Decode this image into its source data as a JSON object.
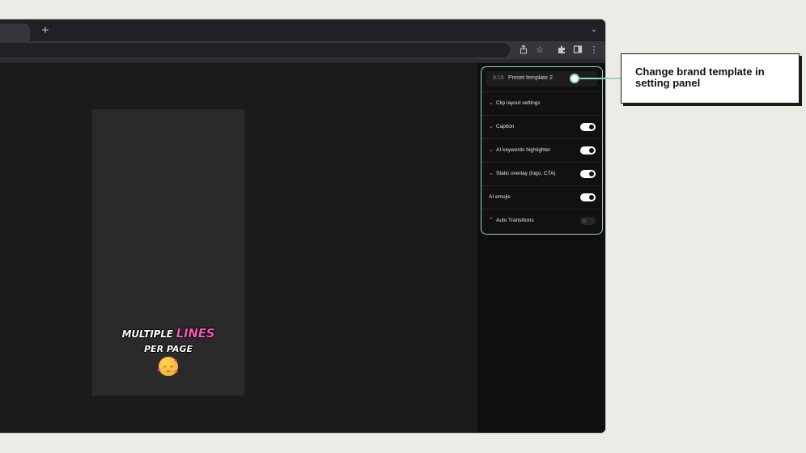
{
  "browser": {
    "new_tab_symbol": "+",
    "tab_menu_symbol": "⌄",
    "toolbar_icons": [
      "share-icon",
      "star-icon",
      "extensions-icon",
      "sidepanel-icon",
      "menu-icon"
    ]
  },
  "preview": {
    "caption_line1_prefix": "MULTIPLE",
    "caption_line1_highlight": "LINES",
    "caption_line2": "PER PAGE",
    "emoji": "smiling-face-with-hearts"
  },
  "panel": {
    "preset": {
      "ratio": "9:16",
      "name": "Preset template 2"
    },
    "rows": [
      {
        "label": "Clip layout settings",
        "chevron": "down",
        "toggle": null
      },
      {
        "label": "Caption",
        "chevron": "down",
        "toggle": true
      },
      {
        "label": "AI keywords highlighter",
        "chevron": "down",
        "toggle": true
      },
      {
        "label": "Static overlay (logo, CTA)",
        "chevron": "down",
        "toggle": true
      },
      {
        "label": "AI emojis",
        "chevron": null,
        "toggle": true
      },
      {
        "label": "Auto Transitions",
        "chevron": "up",
        "toggle": false
      }
    ]
  },
  "callout": {
    "text": "Change brand template in setting panel"
  },
  "colors": {
    "accent": "#96d4b4",
    "highlight": "#f05ab4",
    "background": "#ecebe6",
    "app_bg": "#1b1b1d"
  }
}
